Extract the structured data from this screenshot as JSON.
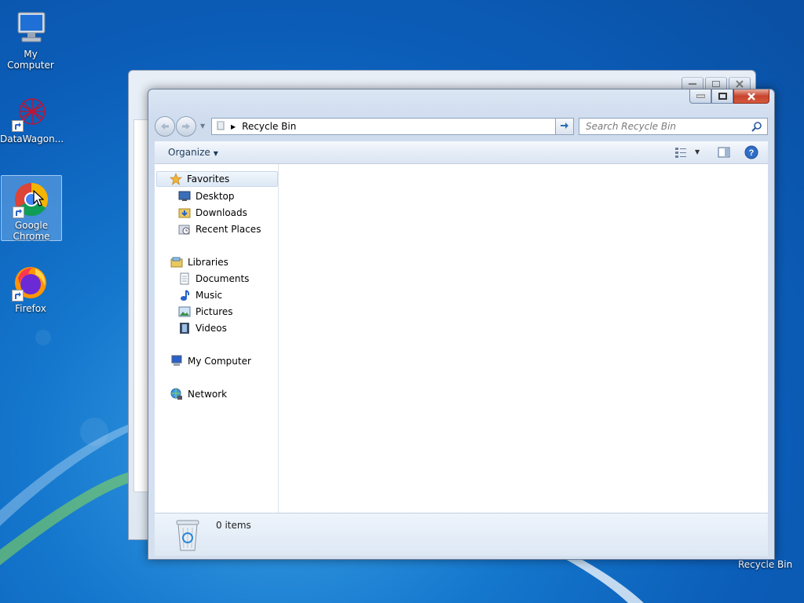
{
  "desktop": {
    "icons": [
      {
        "label": "My Computer",
        "icon": "computer-icon"
      },
      {
        "label": "DataWagon...",
        "icon": "datawagon-icon"
      },
      {
        "label": "Google Chrome",
        "icon": "chrome-icon"
      },
      {
        "label": "Firefox",
        "icon": "firefox-icon"
      }
    ],
    "recycle_bin_label": "Recycle Bin"
  },
  "window": {
    "address": {
      "location": "Recycle Bin"
    },
    "search": {
      "placeholder": "Search Recycle Bin"
    },
    "toolbar": {
      "organize_label": "Organize"
    },
    "nav_pane": {
      "favorites": {
        "label": "Favorites",
        "items": [
          "Desktop",
          "Downloads",
          "Recent Places"
        ]
      },
      "libraries": {
        "label": "Libraries",
        "items": [
          "Documents",
          "Music",
          "Pictures",
          "Videos"
        ]
      },
      "computer": "My Computer",
      "network": "Network"
    },
    "details": {
      "count": "0 items"
    }
  },
  "colors": {
    "accent": "#1e395b",
    "close": "#c7432d"
  }
}
